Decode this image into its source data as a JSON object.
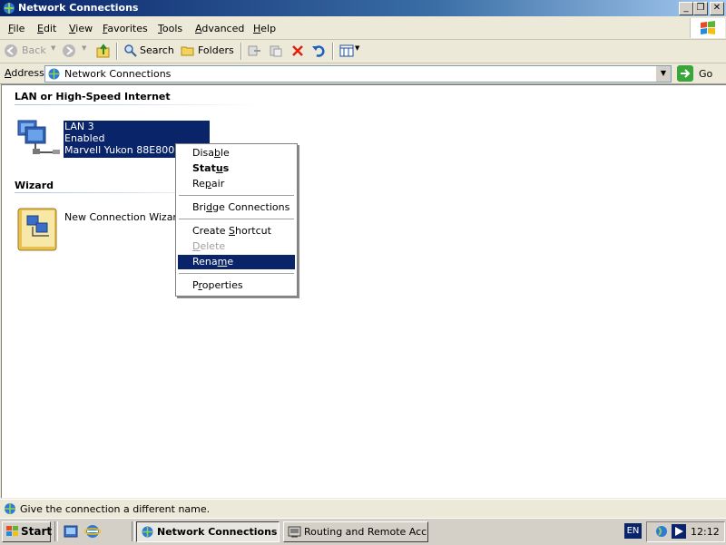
{
  "window": {
    "title": "Network Connections"
  },
  "menu": [
    {
      "label": "File",
      "u": "F",
      "rest": "ile"
    },
    {
      "label": "Edit",
      "u": "E",
      "rest": "dit"
    },
    {
      "label": "View",
      "u": "V",
      "rest": "iew"
    },
    {
      "label": "Favorites",
      "u": "F",
      "rest": "avorites"
    },
    {
      "label": "Tools",
      "u": "T",
      "rest": "ools"
    },
    {
      "label": "Advanced",
      "u": "A",
      "rest": "dvanced"
    },
    {
      "label": "Help",
      "u": "H",
      "rest": "elp"
    }
  ],
  "toolbar": {
    "back": "Back",
    "search": "Search",
    "folders": "Folders"
  },
  "address": {
    "label": "Address",
    "value": "Network Connections",
    "go": "Go"
  },
  "groups": {
    "lan": {
      "header": "LAN or High-Speed Internet",
      "item": {
        "name": "LAN 3",
        "status": "Enabled",
        "device": "Marvell Yukon 88E8001/8"
      }
    },
    "wizard": {
      "header": "Wizard",
      "item": {
        "name": "New Connection Wizard"
      }
    }
  },
  "context_menu": {
    "items": [
      {
        "label": "Disable"
      },
      {
        "label": "Status"
      },
      {
        "label": "Repair"
      },
      {
        "label": "Bridge Connections"
      },
      {
        "label": "Create Shortcut"
      },
      {
        "label": "Delete"
      },
      {
        "label": "Rename"
      },
      {
        "label": "Properties"
      }
    ]
  },
  "statusbar": {
    "text": "Give the connection a different name."
  },
  "taskbar": {
    "start": "Start",
    "tasks": [
      {
        "label": "Network Connections"
      },
      {
        "label": "Routing and Remote Acc..."
      }
    ],
    "lang": "EN",
    "clock": "12:12"
  },
  "colors": {
    "titlebar": "#0a246a",
    "selection": "#0a246a",
    "taskbar": "#d4d0c8"
  }
}
